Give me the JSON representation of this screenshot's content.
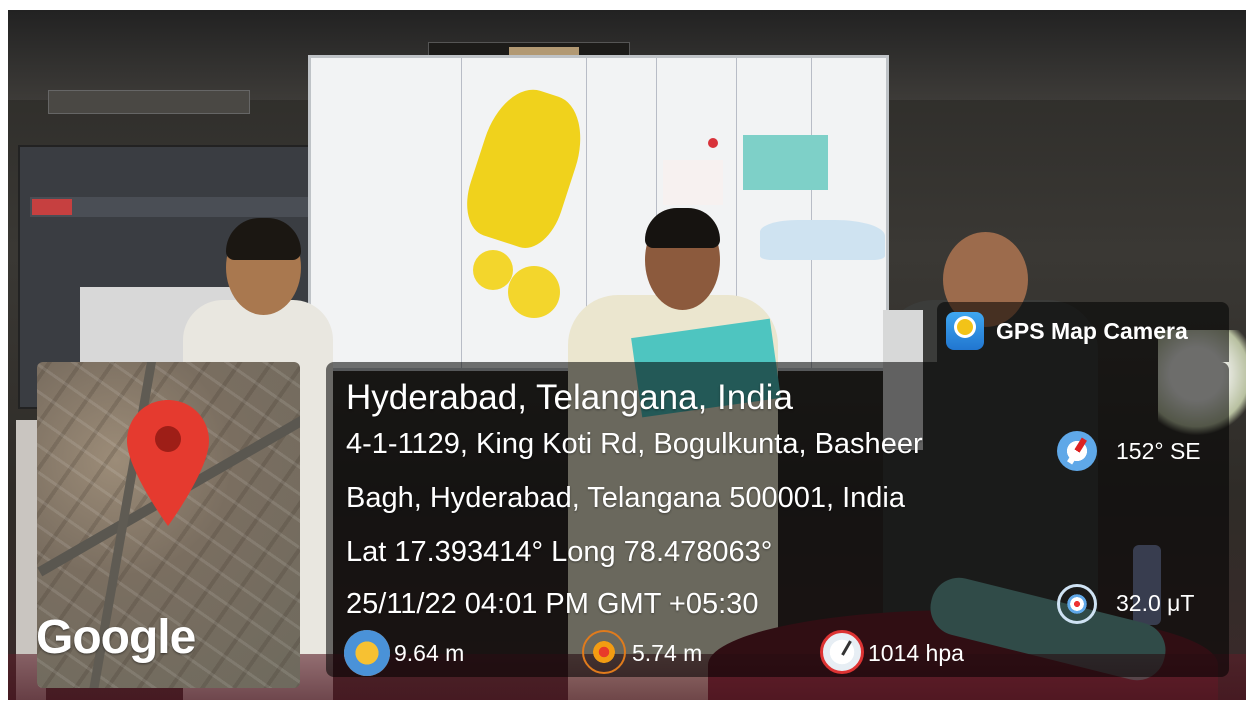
{
  "app": {
    "name": "GPS Map Camera"
  },
  "location": {
    "city_line": "Hyderabad, Telangana, India",
    "address_line_1": "4-1-1129, King Koti Rd, Bogulkunta, Basheer",
    "address_line_2": "Bagh, Hyderabad, Telangana 500001, India",
    "lat_long": "Lat 17.393414° Long 78.478063°",
    "datetime": "25/11/22 04:01 PM GMT +05:30"
  },
  "map": {
    "provider_label": "Google",
    "pin_color": "#e53a2f"
  },
  "readings": {
    "compass": "152° SE",
    "magnetic_field": "32.0 μT",
    "altitude": "9.64 m",
    "accuracy": "5.74 m",
    "pressure": "1014 hpa"
  }
}
